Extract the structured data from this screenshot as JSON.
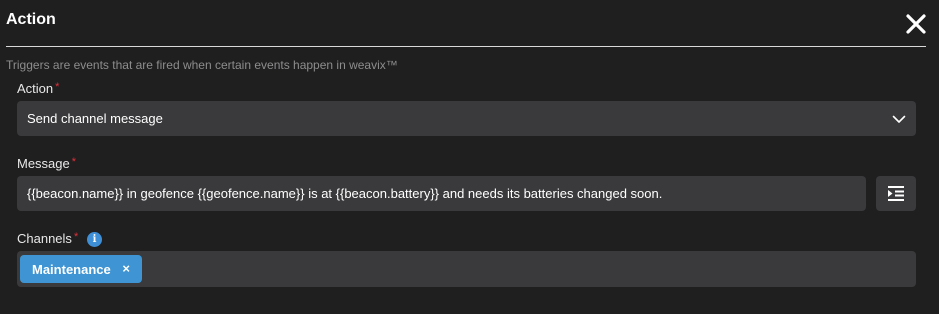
{
  "dialog": {
    "title": "Action",
    "close_icon": "close-icon",
    "subtitle": "Triggers are events that are fired when certain events happen in weavix™"
  },
  "action_field": {
    "label": "Action",
    "required_mark": "*",
    "value": "Send channel message",
    "icon": "chevron-down-icon"
  },
  "message_field": {
    "label": "Message",
    "required_mark": "*",
    "value": "{{beacon.name}} in geofence {{geofence.name}} is at {{beacon.battery}} and needs its batteries changed soon.",
    "insert_button_icon": "insert-variable-icon"
  },
  "channels_field": {
    "label": "Channels",
    "required_mark": "*",
    "info_icon": "info-icon",
    "info_glyph": "i",
    "chips": [
      {
        "label": "Maintenance",
        "remove_glyph": "×"
      }
    ]
  },
  "colors": {
    "background": "#1f1f20",
    "field_background": "#3a3a3c",
    "accent": "#3f95d3",
    "required": "#e0313a"
  }
}
